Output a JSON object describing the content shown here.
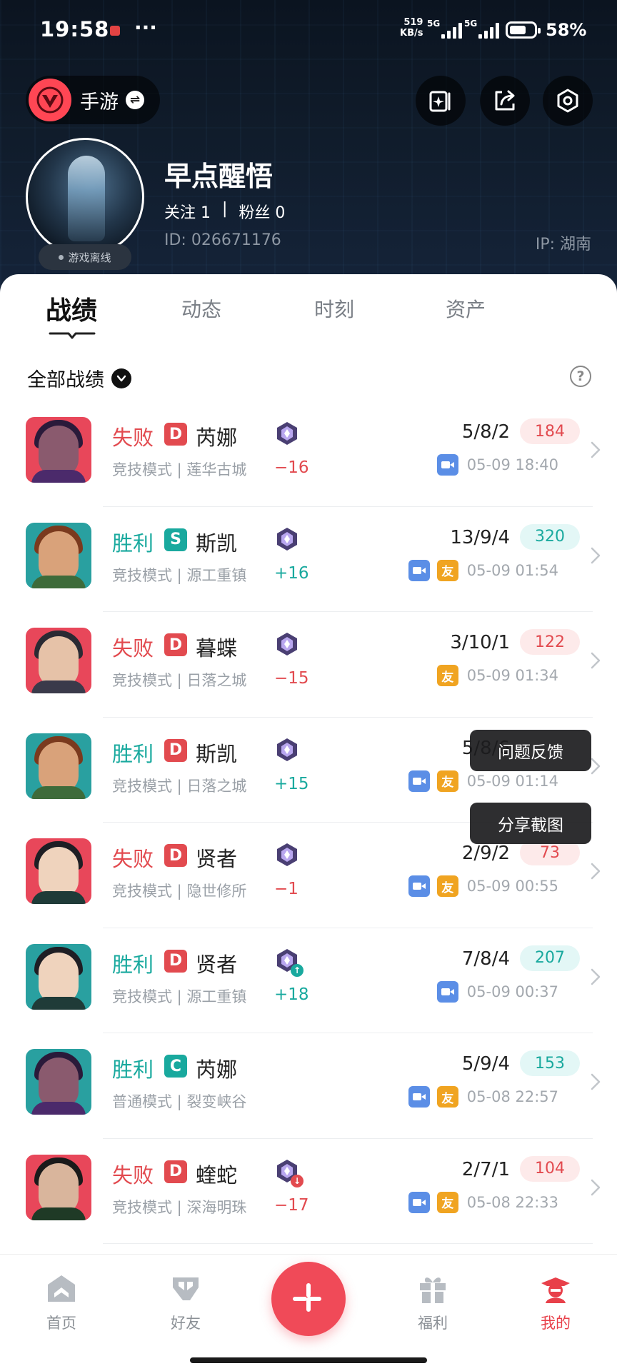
{
  "status_bar": {
    "time": "19:58",
    "network_speed": "519",
    "network_unit": "KB/s",
    "signal_label_1": "5G",
    "signal_label_2": "5G",
    "battery": "58%"
  },
  "header": {
    "game_label": "手游",
    "username": "早点醒悟",
    "following": "关注 1",
    "separator": "|",
    "fans": "粉丝 0",
    "user_id": "ID: 026671176",
    "ip": "IP: 湖南",
    "status": "游戏离线"
  },
  "tabs": [
    {
      "label": "战绩"
    },
    {
      "label": "动态"
    },
    {
      "label": "时刻"
    },
    {
      "label": "资产"
    }
  ],
  "filter": {
    "label": "全部战绩"
  },
  "matches": [
    {
      "result": "失败",
      "grade": "D",
      "agent": "芮娜",
      "mode": "竞技模式 | 莲华古城",
      "rank_delta": "−16",
      "kda": "5/8/2",
      "score": "184",
      "time": "05-09 18:40",
      "video": true,
      "friend": false
    },
    {
      "result": "胜利",
      "grade": "S",
      "agent": "斯凯",
      "mode": "竞技模式 | 源工重镇",
      "rank_delta": "+16",
      "kda": "13/9/4",
      "score": "320",
      "time": "05-09 01:54",
      "video": true,
      "friend": true
    },
    {
      "result": "失败",
      "grade": "D",
      "agent": "暮蝶",
      "mode": "竞技模式 | 日落之城",
      "rank_delta": "−15",
      "kda": "3/10/1",
      "score": "122",
      "time": "05-09 01:34",
      "video": false,
      "friend": true
    },
    {
      "result": "胜利",
      "grade": "D",
      "agent": "斯凯",
      "mode": "竞技模式 | 日落之城",
      "rank_delta": "+15",
      "kda": "5/8/6",
      "score": "",
      "time": "05-09 01:14",
      "video": true,
      "friend": true
    },
    {
      "result": "失败",
      "grade": "D",
      "agent": "贤者",
      "mode": "竞技模式 | 隐世修所",
      "rank_delta": "−1",
      "kda": "2/9/2",
      "score": "73",
      "time": "05-09 00:55",
      "video": true,
      "friend": true
    },
    {
      "result": "胜利",
      "grade": "D",
      "agent": "贤者",
      "mode": "竞技模式 | 源工重镇",
      "rank_delta": "+18",
      "kda": "7/8/4",
      "score": "207",
      "time": "05-09 00:37",
      "video": true,
      "friend": false
    },
    {
      "result": "胜利",
      "grade": "C",
      "agent": "芮娜",
      "mode": "普通模式 | 裂变峡谷",
      "rank_delta": "",
      "kda": "5/9/4",
      "score": "153",
      "time": "05-08 22:57",
      "video": true,
      "friend": true
    },
    {
      "result": "失败",
      "grade": "D",
      "agent": "蝰蛇",
      "mode": "竞技模式 | 深海明珠",
      "rank_delta": "−17",
      "kda": "2/7/1",
      "score": "104",
      "time": "05-08 22:33",
      "video": true,
      "friend": true
    }
  ],
  "chip_labels": {
    "friend": "友"
  },
  "context_menu": {
    "feedback": "问题反馈",
    "share": "分享截图"
  },
  "nav": [
    {
      "label": "首页"
    },
    {
      "label": "好友"
    },
    {
      "label": "福利"
    },
    {
      "label": "我的"
    }
  ],
  "colors": {
    "win": "#19a99e",
    "lose": "#e24a4f",
    "accent": "#f04a58",
    "grade_S": "#19a99e",
    "grade_C": "#19a99e",
    "grade_D": "#e24a4f"
  }
}
